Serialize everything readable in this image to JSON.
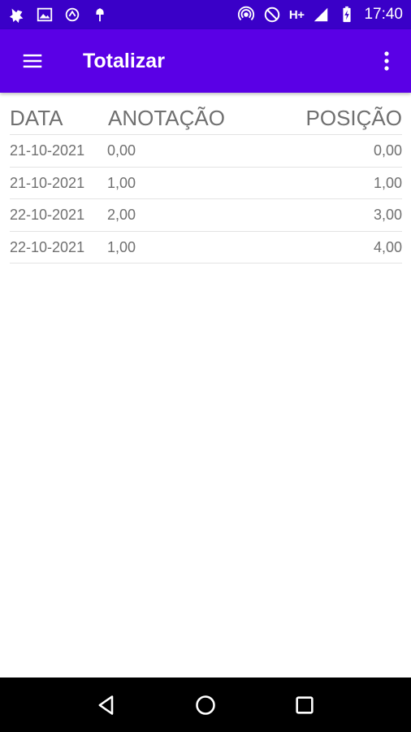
{
  "status_bar": {
    "network_type": "H+",
    "time": "17:40",
    "left_icons": [
      "app-notification-icon",
      "image-icon",
      "sync-icon",
      "android-debug-icon"
    ],
    "right_icons": [
      "hotspot-icon",
      "do-not-disturb-icon",
      "signal-icon",
      "battery-charging-icon"
    ]
  },
  "toolbar": {
    "title": "Totalizar",
    "background": "#5a00e6"
  },
  "table": {
    "headers": {
      "data": "DATA",
      "anotacao": "ANOTAÇÃO",
      "posicao": "POSIÇÃO"
    },
    "rows": [
      {
        "data": "21-10-2021",
        "anotacao": "0,00",
        "posicao": "0,00"
      },
      {
        "data": "21-10-2021",
        "anotacao": "1,00",
        "posicao": "1,00"
      },
      {
        "data": "22-10-2021",
        "anotacao": "2,00",
        "posicao": "3,00"
      },
      {
        "data": "22-10-2021",
        "anotacao": "1,00",
        "posicao": "4,00"
      }
    ]
  },
  "nav_bar": {
    "buttons": [
      "back-icon",
      "home-icon",
      "recents-icon"
    ]
  }
}
